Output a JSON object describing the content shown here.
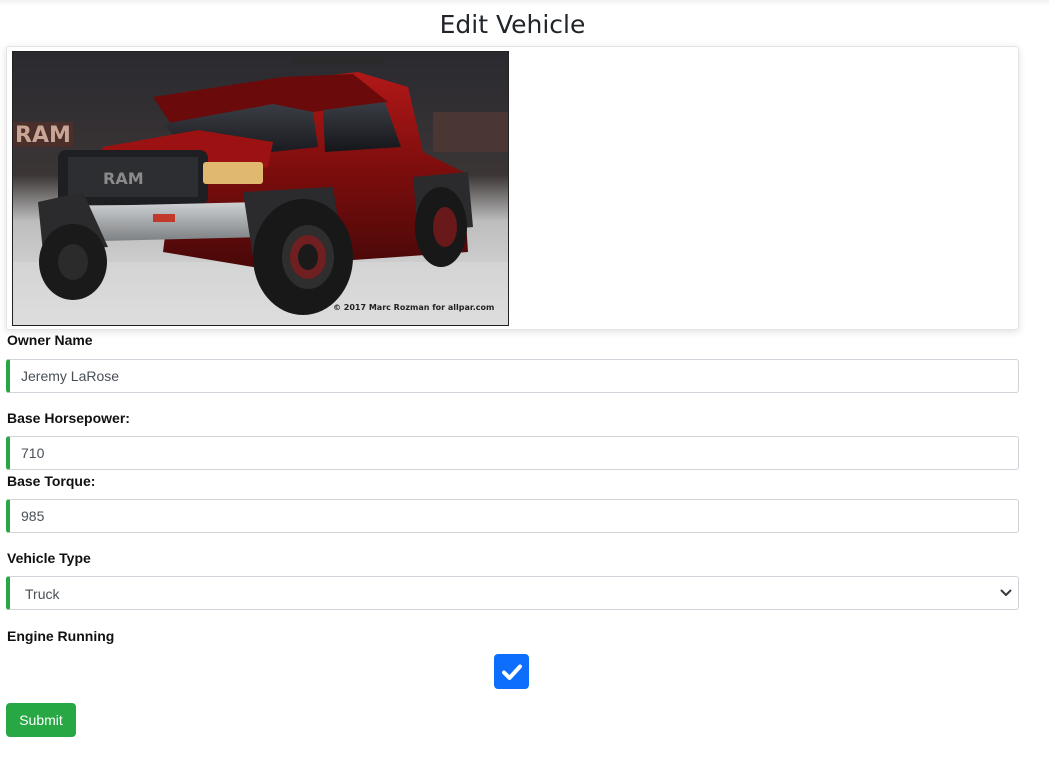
{
  "page": {
    "title": "Edit Vehicle"
  },
  "vehicle_image": {
    "alt": "Red Ram Rebel TRX pickup truck",
    "caption": "© 2017 Marc Rozman for allpar.com"
  },
  "form": {
    "owner_name": {
      "label": "Owner Name",
      "value": "Jeremy LaRose"
    },
    "base_horsepower": {
      "label": "Base Horsepower:",
      "value": "710"
    },
    "base_torque": {
      "label": "Base Torque:",
      "value": "985"
    },
    "vehicle_type": {
      "label": "Vehicle Type",
      "selected": "Truck"
    },
    "engine_running": {
      "label": "Engine Running",
      "checked": true
    },
    "submit_label": "Submit"
  },
  "colors": {
    "valid_accent": "#28a745",
    "checkbox_accent": "#0d6efd",
    "submit_bg": "#28a745"
  }
}
